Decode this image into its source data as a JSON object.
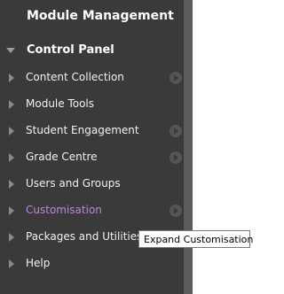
{
  "panel": {
    "title": "Module Management",
    "control_panel_label": "Control Panel",
    "items": [
      {
        "label": "Content Collection",
        "has_go": true
      },
      {
        "label": "Module Tools",
        "has_go": false
      },
      {
        "label": "Student Engagement",
        "has_go": true
      },
      {
        "label": "Grade Centre",
        "has_go": true
      },
      {
        "label": "Users and Groups",
        "has_go": false
      },
      {
        "label": "Customisation",
        "has_go": true,
        "active": true
      },
      {
        "label": "Packages and Utilities",
        "has_go": false
      },
      {
        "label": "Help",
        "has_go": false
      }
    ]
  },
  "tooltip": {
    "text": "Expand Customisation"
  },
  "colors": {
    "panel_bg": "#3a3a3a",
    "active_label": "#b98bd2",
    "divider": "#5c5c5c"
  }
}
